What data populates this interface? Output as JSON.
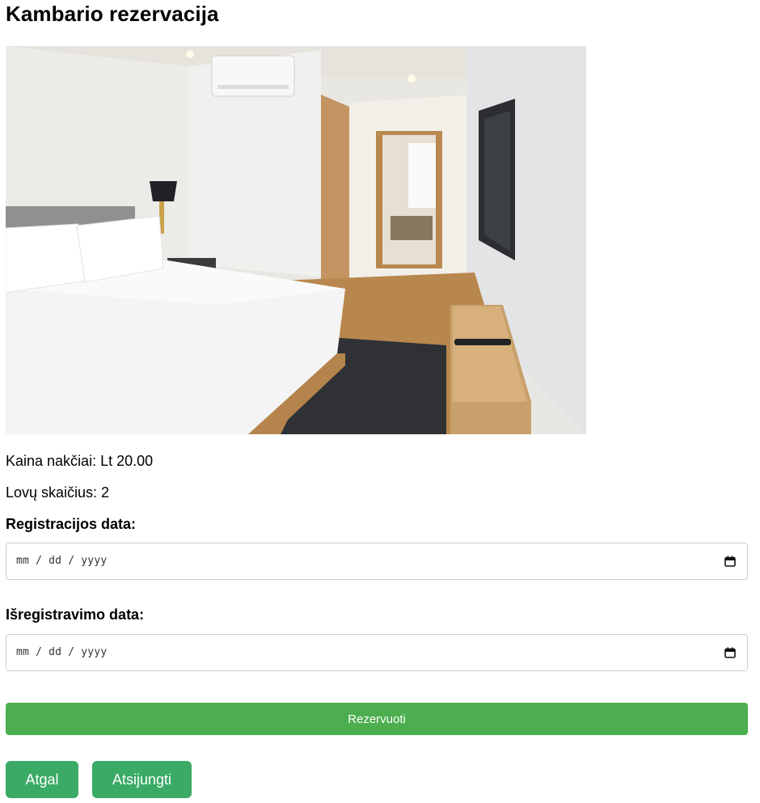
{
  "page": {
    "title": "Kambario rezervacija"
  },
  "room": {
    "image_alt": "Hotel room with a double bed, wall TV and wooden floor",
    "price_text": "Kaina nakčiai: Lt 20.00",
    "beds_text": "Lovų skaičius: 2"
  },
  "form": {
    "checkin": {
      "label": "Registracijos data:",
      "placeholder": "mm / dd / yyyy"
    },
    "checkout": {
      "label": "Išregistravimo data:",
      "placeholder": "mm / dd / yyyy"
    },
    "submit_label": "Rezervuoti"
  },
  "nav": {
    "back_label": "Atgal",
    "logout_label": "Atsijungti"
  },
  "colors": {
    "submit": "#4cae4f",
    "nav_buttons": "#3aaa66"
  },
  "icons": {
    "date_picker": "calendar-icon"
  }
}
